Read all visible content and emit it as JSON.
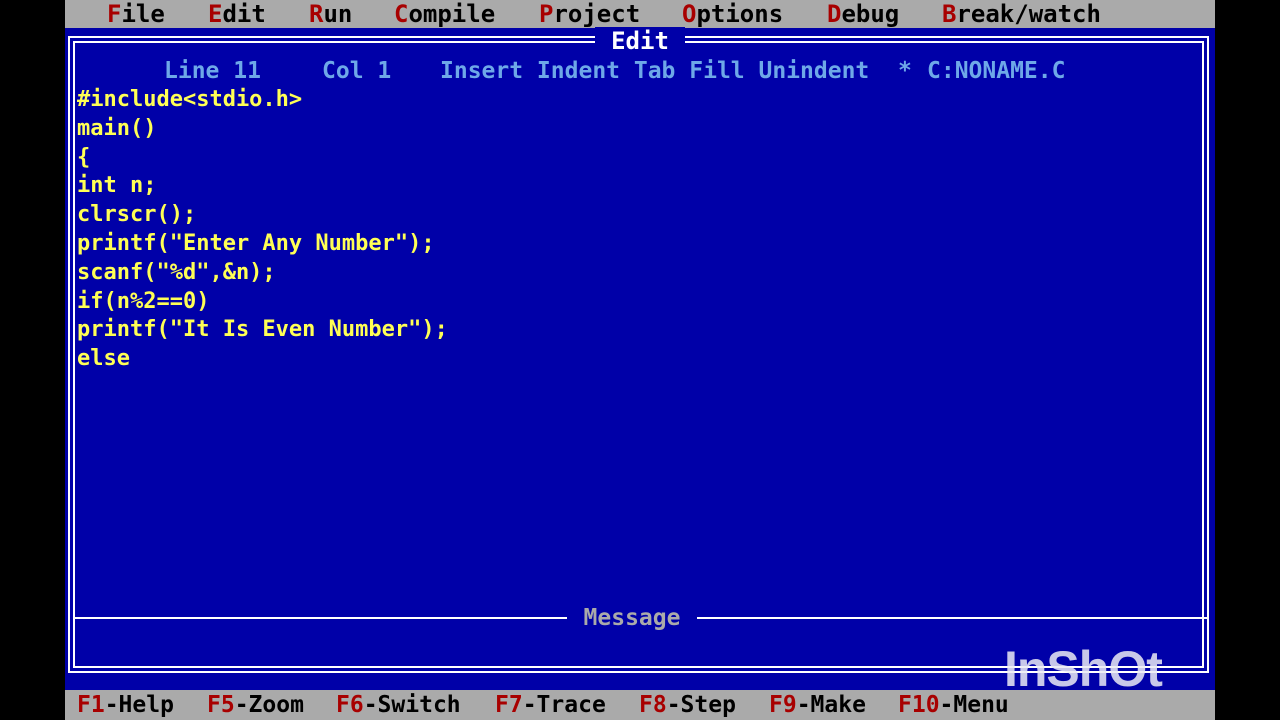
{
  "menu": [
    {
      "hot": "F",
      "rest": "ile"
    },
    {
      "hot": "E",
      "rest": "dit"
    },
    {
      "hot": "R",
      "rest": "un"
    },
    {
      "hot": "C",
      "rest": "ompile"
    },
    {
      "hot": "P",
      "rest": "roject"
    },
    {
      "hot": "O",
      "rest": "ptions"
    },
    {
      "hot": "D",
      "rest": "ebug"
    },
    {
      "hot": "B",
      "rest": "reak/watch"
    }
  ],
  "editor": {
    "title": "Edit",
    "status": {
      "line": "Line 11",
      "col": "Col 1",
      "modes": "Insert Indent Tab Fill Unindent",
      "modified_marker": "*",
      "filename": "C:NONAME.C"
    },
    "code": [
      "#include<stdio.h>",
      "main()",
      "{",
      "int n;",
      "clrscr();",
      "printf(\"Enter Any Number\");",
      "scanf(\"%d\",&n);",
      "if(n%2==0)",
      "printf(\"It Is Even Number\");",
      "else"
    ]
  },
  "message_panel": {
    "title": "Message"
  },
  "fkeys": [
    {
      "key": "F1",
      "label": "-Help"
    },
    {
      "key": "F5",
      "label": "-Zoom"
    },
    {
      "key": "F6",
      "label": "-Switch"
    },
    {
      "key": "F7",
      "label": "-Trace"
    },
    {
      "key": "F8",
      "label": "-Step"
    },
    {
      "key": "F9",
      "label": "-Make"
    },
    {
      "key": "F10",
      "label": "-Menu"
    }
  ],
  "watermark": "InShOt",
  "colors": {
    "background": "#0000a8",
    "code_text": "#ffff55",
    "status_text": "#6ea8e8",
    "hotkey": "#a80000",
    "bars": "#aaaaaa"
  }
}
